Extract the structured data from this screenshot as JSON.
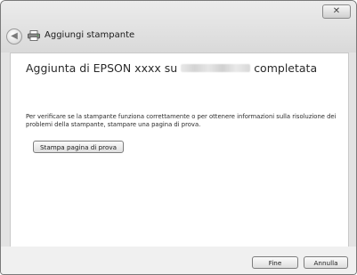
{
  "window": {
    "title": "Aggiungi stampante",
    "close_label": "✕"
  },
  "main": {
    "heading_prefix": "Aggiunta di EPSON xxxx su",
    "heading_suffix": "completata",
    "description": "Per verificare se la stampante funziona correttamente o per ottenere informazioni sulla risoluzione dei problemi della stampante, stampare una pagina di prova.",
    "test_page_button": "Stampa pagina di prova"
  },
  "footer": {
    "finish_button": "Fine",
    "cancel_button": "Annulla"
  },
  "icons": {
    "back": "back-arrow-icon",
    "printer": "printer-icon",
    "close": "close-icon"
  }
}
